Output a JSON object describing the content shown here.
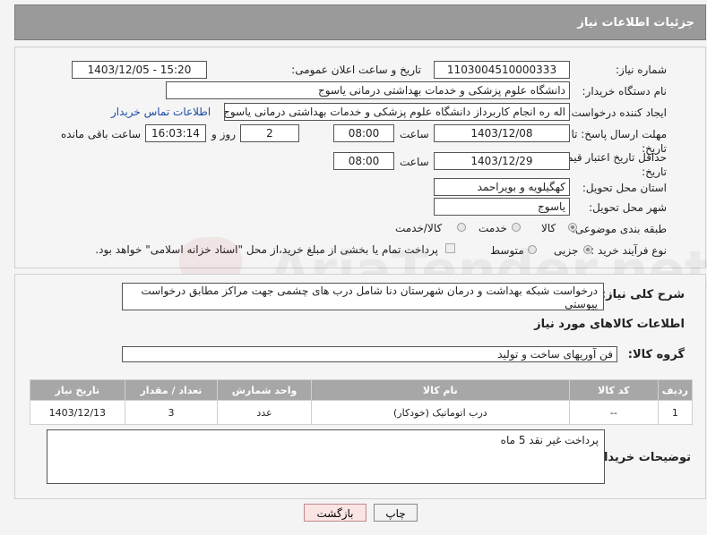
{
  "header": {
    "title": "جزئیات اطلاعات نیاز"
  },
  "form": {
    "need_number": {
      "label": "شماره نیاز:",
      "value": "1103004510000333"
    },
    "announce_datetime": {
      "label": "تاریخ و ساعت اعلان عمومی:",
      "value": "1403/12/05 - 15:20"
    },
    "buyer_org": {
      "label": "نام دستگاه خریدار:",
      "value": "دانشگاه علوم پزشکی و خدمات بهداشتی  درمانی یاسوج"
    },
    "requester": {
      "label": "ایجاد کننده درخواست:",
      "value": "اله ره انجام کاربرداز دانشگاه علوم پزشکی و خدمات بهداشتی  درمانی یاسوج",
      "contact_link": "اطلاعات تماس خریدار"
    },
    "reply_deadline": {
      "label_line1": "مهلت ارسال پاسخ: تا",
      "label_line2": "تاریخ:",
      "date": "1403/12/08",
      "time_label": "ساعت",
      "time": "08:00",
      "days": "2",
      "days_label": "روز و",
      "remaining": "16:03:14",
      "remaining_label": "ساعت باقی مانده"
    },
    "price_validity": {
      "label_line1": "حداقل تاریخ اعتبار قیمت: تا",
      "label_line2": "تاریخ:",
      "date": "1403/12/29",
      "time_label": "ساعت",
      "time": "08:00"
    },
    "province": {
      "label": "استان محل تحویل:",
      "value": "کهگیلویه و بویراحمد"
    },
    "city": {
      "label": "شهر محل تحویل:",
      "value": "یاسوج"
    },
    "category": {
      "label": "طبقه بندی موضوعی:",
      "options": [
        "کالا",
        "خدمت",
        "کالا/خدمت"
      ],
      "selected": "کالا"
    },
    "purchase_process": {
      "label": "نوع فرآیند خرید :",
      "options": [
        "جزیی",
        "متوسط"
      ],
      "selected": "جزیی",
      "treasury_note": "پرداخت تمام یا بخشی از مبلغ خرید،از محل \"اسناد خزانه اسلامی\" خواهد بود."
    }
  },
  "details": {
    "summary_label": "شرح کلی نیاز:",
    "summary": "درخواست شبکه بهداشت و درمان شهرستان دنا شامل درب های چشمی جهت مراکز مطابق درخواست پیوستی",
    "goods_title": "اطلاعات کالاهای مورد نیاز",
    "goods_group_label": "گروه کالا:",
    "goods_group": "فن آوریهای ساخت و تولید",
    "table": {
      "headers": [
        "ردیف",
        "کد کالا",
        "نام کالا",
        "واحد شمارش",
        "تعداد / مقدار",
        "تاریخ نیاز"
      ],
      "rows": [
        [
          "1",
          "--",
          "درب اتوماتیک (خودکار)",
          "عدد",
          "3",
          "1403/12/13"
        ]
      ]
    },
    "buyer_notes_label": "توضیحات خریدار:",
    "buyer_notes": "پرداخت غیر نقد 5 ماه"
  },
  "buttons": {
    "print": "چاپ",
    "back": "بازگشت"
  },
  "watermark": {
    "text": "AriaTender.net"
  },
  "colors": {
    "header_bg": "#9a9a9a",
    "link": "#1a4aa6",
    "table_header": "#a7a7a7"
  }
}
